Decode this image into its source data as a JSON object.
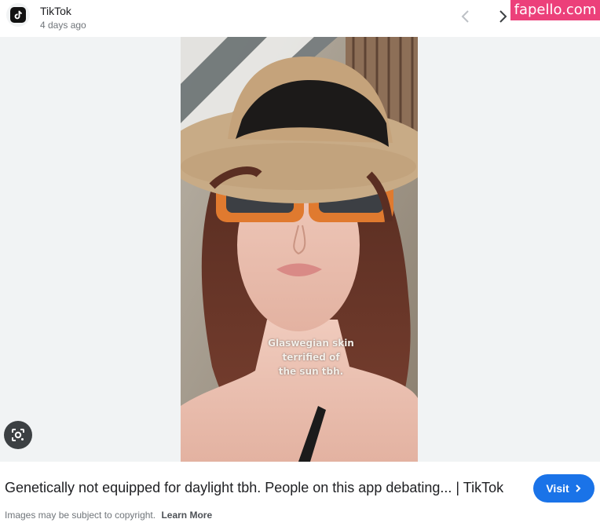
{
  "header": {
    "source_name": "TikTok",
    "age": "4 days ago",
    "app_icon": "tiktok-logo",
    "nav": {
      "prev_icon": "chevron-left",
      "next_icon": "chevron-right"
    }
  },
  "watermark": "fapello.com",
  "image": {
    "caption_lines": [
      "Glaswegian skin",
      "terrified of",
      "the sun tbh."
    ]
  },
  "lens_icon": "google-lens",
  "footer": {
    "title": "Genetically not equipped for daylight tbh. People on this app debating... | TikTok",
    "visit_label": "Visit",
    "copyright": "Images may be subject to copyright.",
    "learn_more": "Learn More"
  },
  "colors": {
    "visit": "#1a73e8",
    "watermark": "#ec407a",
    "viewer_bg": "#f1f3f4"
  }
}
